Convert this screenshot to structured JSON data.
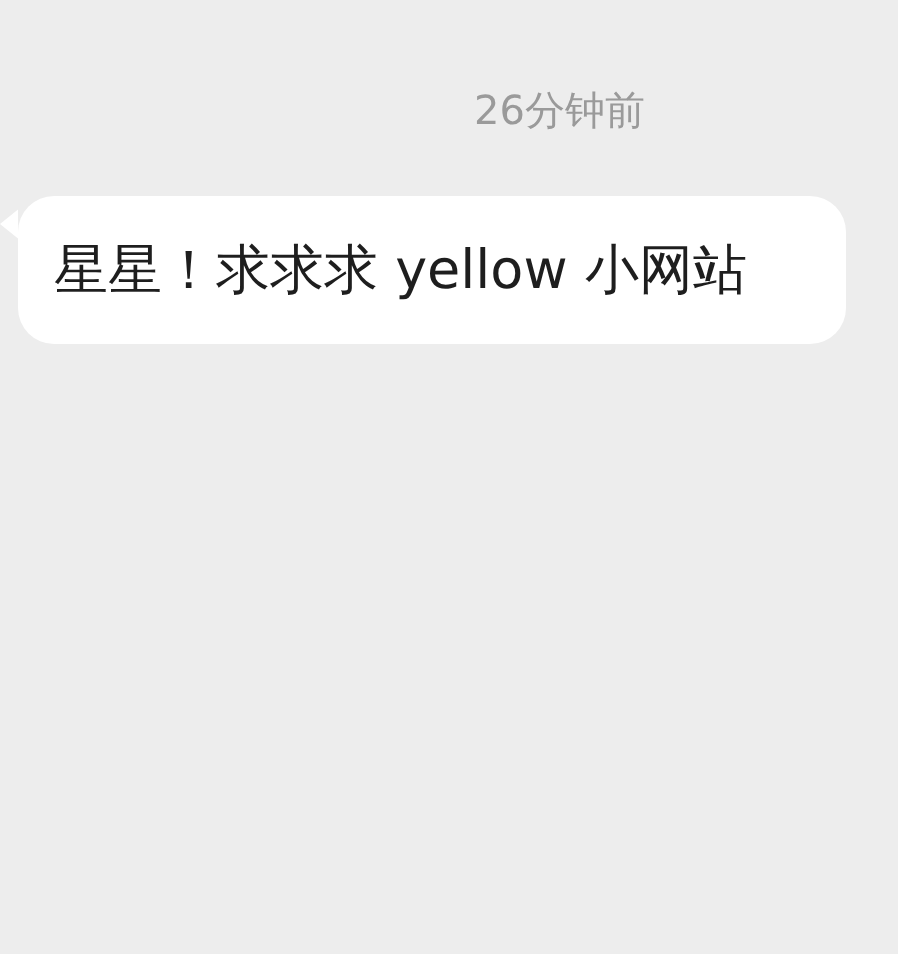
{
  "timestamp": "26分钟前",
  "messages": [
    {
      "text": "星星！求求求 yellow 小网站"
    }
  ]
}
